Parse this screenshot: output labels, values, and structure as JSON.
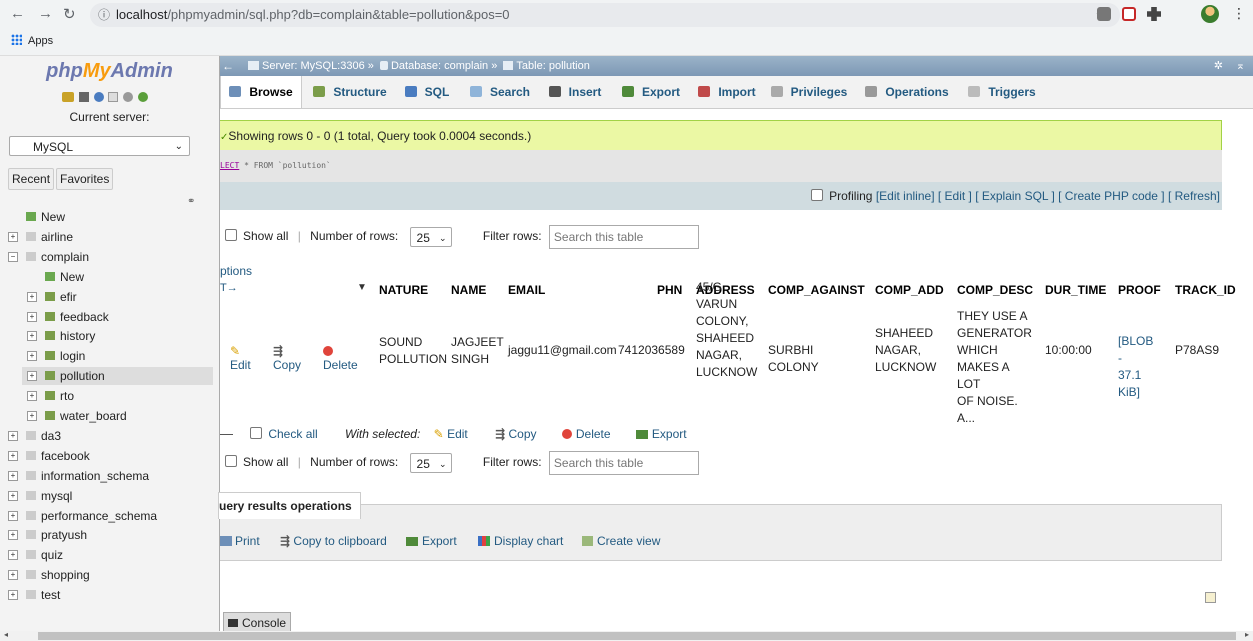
{
  "browser": {
    "url_host": "localhost",
    "url_rest": "/phpmyadmin/sql.php?db=complain&table=pollution&pos=0",
    "bookmarks_apps": "Apps"
  },
  "sidebar": {
    "logo_php": "php",
    "logo_my": "My",
    "logo_admin": "Admin",
    "current_server_label": "Current server:",
    "server_value": "MySQL",
    "recent": "Recent",
    "favorites": "Favorites",
    "tree": [
      {
        "label": "New",
        "level": 0
      },
      {
        "label": "airline",
        "level": 0
      },
      {
        "label": "complain",
        "level": 0
      },
      {
        "label": "New",
        "level": 1
      },
      {
        "label": "efir",
        "level": 1
      },
      {
        "label": "feedback",
        "level": 1
      },
      {
        "label": "history",
        "level": 1
      },
      {
        "label": "login",
        "level": 1
      },
      {
        "label": "pollution",
        "level": 1
      },
      {
        "label": "rto",
        "level": 1
      },
      {
        "label": "water_board",
        "level": 1
      },
      {
        "label": "da3",
        "level": 0
      },
      {
        "label": "facebook",
        "level": 0
      },
      {
        "label": "information_schema",
        "level": 0
      },
      {
        "label": "mysql",
        "level": 0
      },
      {
        "label": "performance_schema",
        "level": 0
      },
      {
        "label": "pratyush",
        "level": 0
      },
      {
        "label": "quiz",
        "level": 0
      },
      {
        "label": "shopping",
        "level": 0
      },
      {
        "label": "test",
        "level": 0
      }
    ]
  },
  "breadcrumb": {
    "server": "Server: MySQL:3306",
    "database": "Database: complain",
    "table": "Table: pollution"
  },
  "tabs": [
    "Browse",
    "Structure",
    "SQL",
    "Search",
    "Insert",
    "Export",
    "Import",
    "Privileges",
    "Operations",
    "Triggers"
  ],
  "status_message": "Showing rows 0 - 0 (1 total, Query took 0.0004 seconds.)",
  "sql_text_kw": "LECT",
  "sql_text_rest": " * FROM `pollution`",
  "tools": {
    "profiling": "Profiling",
    "links": "[Edit inline] [ Edit ] [ Explain SQL ] [ Create PHP code ] [ Refresh]"
  },
  "nav": {
    "show_all": "Show all",
    "rows_label": "Number of rows:",
    "rows_value": "25",
    "filter_label": "Filter rows:",
    "filter_placeholder": "Search this table"
  },
  "options_link": "ptions",
  "columns": [
    "NATURE",
    "NAME",
    "EMAIL",
    "PHN",
    "ADDRESS",
    "COMP_AGAINST",
    "COMP_ADD",
    "COMP_DESC",
    "DUR_TIME",
    "PROOF",
    "TRACK_ID"
  ],
  "row": {
    "actions": [
      "Edit",
      "Copy",
      "Delete"
    ],
    "nature": [
      "SOUND",
      "POLLUTION"
    ],
    "name": [
      "JAGJEET",
      "SINGH"
    ],
    "email": "jaggu11@gmail.com",
    "phn": "7412036589",
    "address": [
      "45/G",
      "VARUN",
      "COLONY,",
      "SHAHEED",
      "NAGAR,",
      "LUCKNOW"
    ],
    "comp_against": "SURBHI COLONY",
    "comp_add": [
      "SHAHEED",
      "NAGAR,",
      "LUCKNOW"
    ],
    "comp_desc": [
      "THEY USE A",
      "GENERATOR",
      "WHICH",
      "MAKES A LOT",
      "OF NOISE. A..."
    ],
    "dur_time": "10:00:00",
    "proof": [
      "[BLOB -",
      "37.1 KiB]"
    ],
    "track_id": "P78AS9"
  },
  "bulk": {
    "check_all": "Check all",
    "with_selected": "With selected:",
    "edit": "Edit",
    "copy": "Copy",
    "delete": "Delete",
    "export": "Export"
  },
  "query_ops": {
    "title": "uery results operations",
    "print": "Print",
    "copy_clipboard": "Copy to clipboard",
    "export": "Export",
    "display_chart": "Display chart",
    "create_view": "Create view"
  },
  "console": "Console"
}
